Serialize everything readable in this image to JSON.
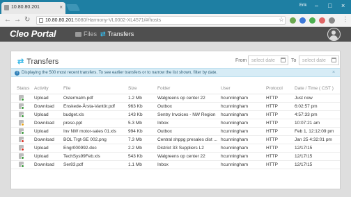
{
  "browser": {
    "tab_title": "10.80.80.201",
    "user_label": "Erik",
    "url_host": "10.80.80.201",
    "url_rest": ":5080/Harmony-VL0002-XL4571/#/hosts"
  },
  "app": {
    "logo": "Cleo Portal",
    "nav": [
      {
        "label": "Files",
        "active": false
      },
      {
        "label": "Transfers",
        "active": true
      }
    ]
  },
  "panel": {
    "title": "Transfers",
    "from_label": "From",
    "to_label": "To",
    "from_placeholder": "select date",
    "to_placeholder": "select date",
    "info": "Displaying the 500 most recent transfers. To see earlier transfers or to narrow the list shown, filter by date.",
    "columns": [
      "Status",
      "Activity",
      "File",
      "Size",
      "Folder",
      "User",
      "Protocol",
      "Date / Time ( CST )"
    ],
    "rows": [
      {
        "status": "ok",
        "activity": "Upload",
        "file": "Ostermalm.pdf",
        "size": "1.2 Mb",
        "folder": "Walgreens op center 22",
        "user": "hcunningham",
        "protocol": "HTTP",
        "date": "Just now"
      },
      {
        "status": "ok",
        "activity": "Download",
        "file": "Enskede-Årsta-Vantör.pdf",
        "size": "963 Kb",
        "folder": "Outbox",
        "user": "hcunningham",
        "protocol": "HTTP",
        "date": "6:02:57 pm"
      },
      {
        "status": "ok",
        "activity": "Upload",
        "file": "budget.xls",
        "size": "143 Kb",
        "folder": "Sentry Invoices - NW Region",
        "user": "hcunningham",
        "protocol": "HTTP",
        "date": "4:57:33 pm"
      },
      {
        "status": "warn",
        "activity": "Download",
        "file": "preso.ppt",
        "size": "5.3 Mb",
        "folder": "Inbox",
        "user": "hcunningham",
        "protocol": "HTTP",
        "date": "10:07:21 am"
      },
      {
        "status": "ok",
        "activity": "Upload",
        "file": "Inv NW motor-sales 01.xls",
        "size": "994 Kb",
        "folder": "Outbox",
        "user": "hcunningham",
        "protocol": "HTTP",
        "date": "Feb 1, 12:12:09 pm"
      },
      {
        "status": "err",
        "activity": "Download",
        "file": "BOL Trgt-SE 002.png",
        "size": "7.3 Mb",
        "folder": "Central shppg presales dist ...",
        "user": "hcunningham",
        "protocol": "HTTP",
        "date": "Jan 25 4:32:01 pm"
      },
      {
        "status": "err",
        "activity": "Upload",
        "file": "Engr000992.doc",
        "size": "2.2 Mb",
        "folder": "District 33 Suppliers L2",
        "user": "hcunningham",
        "protocol": "HTTP",
        "date": "12/17/15"
      },
      {
        "status": "ok",
        "activity": "Upload",
        "file": "TechSys99Feb.xls",
        "size": "543 Kb",
        "folder": "Walgreens op center 22",
        "user": "hcunningham",
        "protocol": "HTTP",
        "date": "12/17/15"
      },
      {
        "status": "ok",
        "activity": "Download",
        "file": "Ser83.pdf",
        "size": "1.1 Mb",
        "folder": "Inbox",
        "user": "hcunningham",
        "protocol": "HTTP",
        "date": "12/17/15"
      }
    ]
  },
  "colors": {
    "accent": "#37b8e8",
    "header": "#4f4f4f",
    "chrome": "#1e7fa3"
  }
}
